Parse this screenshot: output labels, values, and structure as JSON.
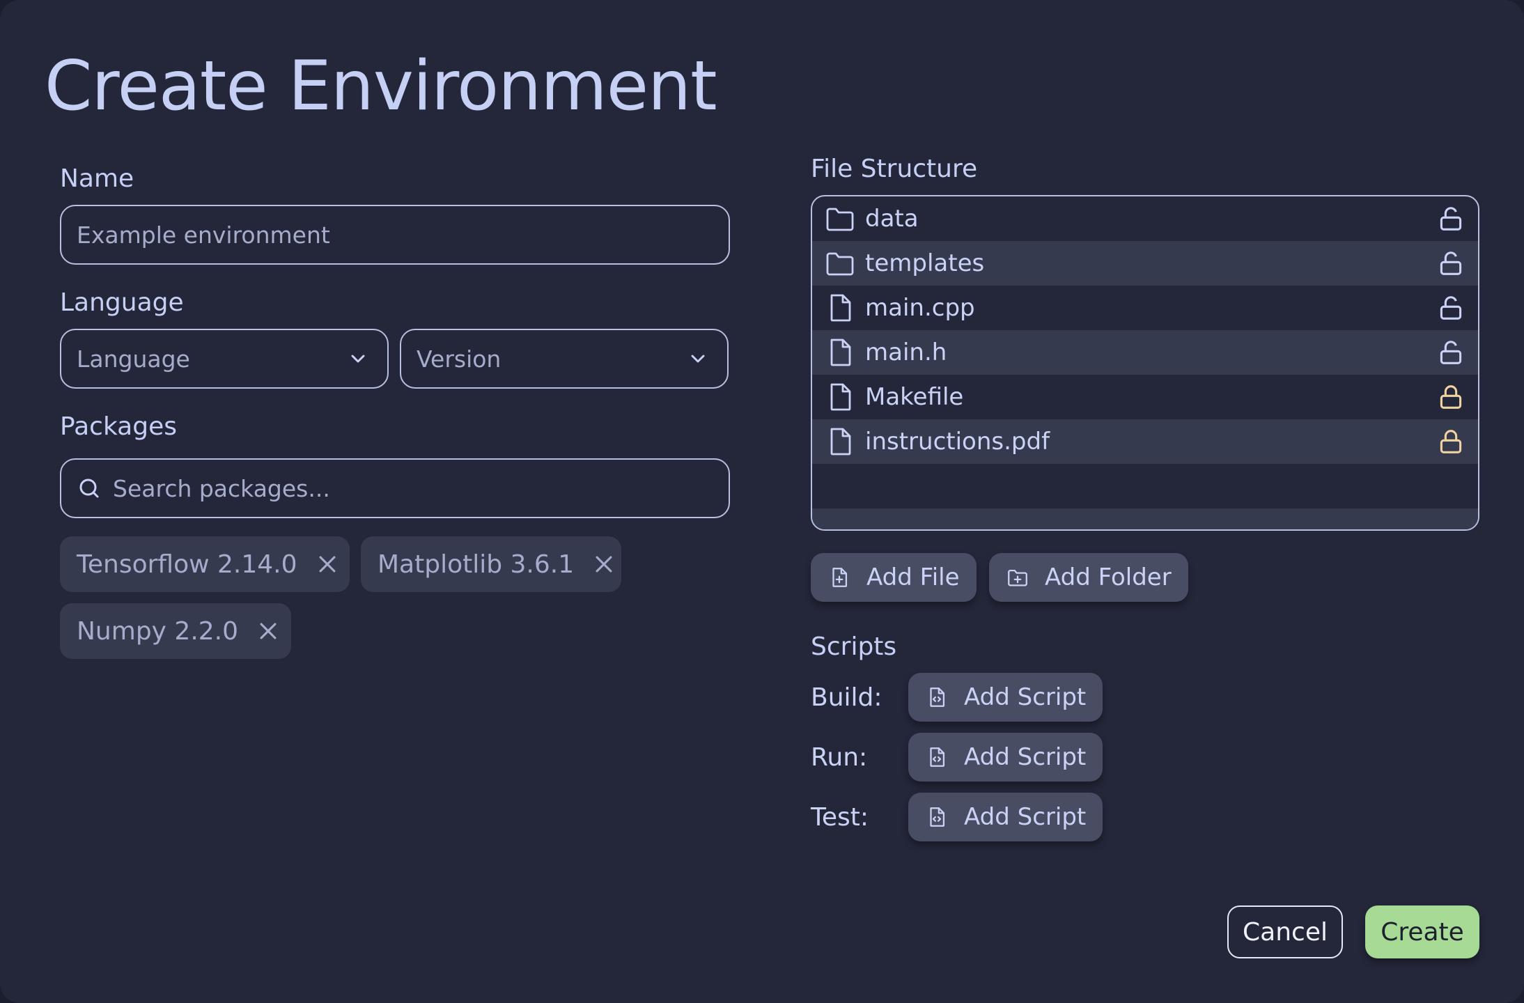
{
  "title": "Create Environment",
  "form": {
    "name_label": "Name",
    "name_placeholder": "Example environment",
    "language_label": "Language",
    "language_select": "Language",
    "version_select": "Version",
    "packages_label": "Packages",
    "packages_search_placeholder": "Search packages...",
    "packages": [
      {
        "label": "Tensorflow 2.14.0"
      },
      {
        "label": "Matplotlib 3.6.1"
      },
      {
        "label": "Numpy 2.2.0"
      }
    ]
  },
  "files": {
    "label": "File Structure",
    "items": [
      {
        "name": "data",
        "type": "folder",
        "locked": false
      },
      {
        "name": "templates",
        "type": "folder",
        "locked": false
      },
      {
        "name": "main.cpp",
        "type": "file",
        "locked": false
      },
      {
        "name": "main.h",
        "type": "file",
        "locked": false
      },
      {
        "name": "Makefile",
        "type": "file",
        "locked": true
      },
      {
        "name": "instructions.pdf",
        "type": "file",
        "locked": true
      }
    ],
    "add_file": "Add File",
    "add_folder": "Add Folder"
  },
  "scripts": {
    "label": "Scripts",
    "rows": [
      {
        "label": "Build:",
        "button": "Add Script"
      },
      {
        "label": "Run:",
        "button": "Add Script"
      },
      {
        "label": "Test:",
        "button": "Add Script"
      }
    ]
  },
  "actions": {
    "cancel": "Cancel",
    "create": "Create"
  },
  "colors": {
    "background": "#24273a",
    "surface": "#363a4f",
    "text": "#cad3f5",
    "lock_unlocked": "#cad3f5",
    "lock_locked": "#eed49f",
    "create_button": "#a6da95"
  },
  "icons": {
    "folder": "folder-icon",
    "file": "file-icon",
    "lock_open": "unlock-icon",
    "lock_closed": "lock-icon",
    "search": "search-icon",
    "chevron": "chevron-down-icon",
    "remove": "close-icon",
    "add_file": "file-plus-icon",
    "add_folder": "folder-plus-icon",
    "script": "file-code-icon"
  }
}
